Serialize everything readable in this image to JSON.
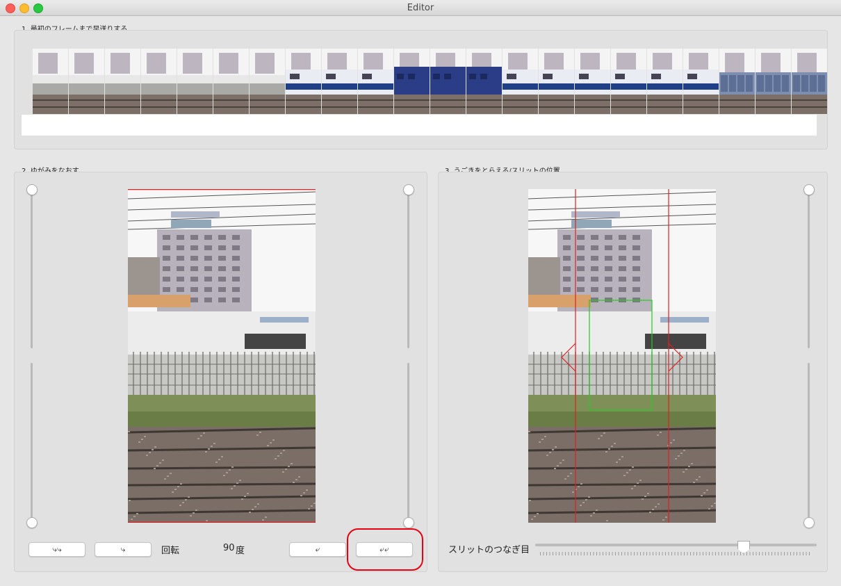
{
  "window": {
    "title": "Editor"
  },
  "sections": {
    "frames_title": "1. 最初のフレームまで早送りする",
    "distortion_title": "2. ゆがみをなおす",
    "motion_title": "3. うごきをとらえる/スリットの位置"
  },
  "frame_strip": {
    "frames": [
      "building",
      "building",
      "building",
      "building",
      "building",
      "building",
      "building",
      "loco",
      "loco",
      "loco",
      "blue-car",
      "blue-car",
      "blue-car",
      "loco",
      "loco",
      "loco",
      "loco",
      "loco",
      "loco",
      "freight",
      "freight",
      "freight"
    ]
  },
  "distortion": {
    "buttons": [
      {
        "label": "⤷⤷"
      },
      {
        "label": "⤷"
      },
      {
        "label": "⤶"
      },
      {
        "label": "⤶⤶"
      }
    ],
    "rotation_label": "回転",
    "rotation_value": "90",
    "rotation_unit": "度"
  },
  "motion": {
    "slit_label": "スリットのつなぎ目",
    "slit_value": 0.72
  },
  "colors": {
    "highlight": "#e60012",
    "slit_line": "#e02020",
    "selection": "#22cc22"
  }
}
